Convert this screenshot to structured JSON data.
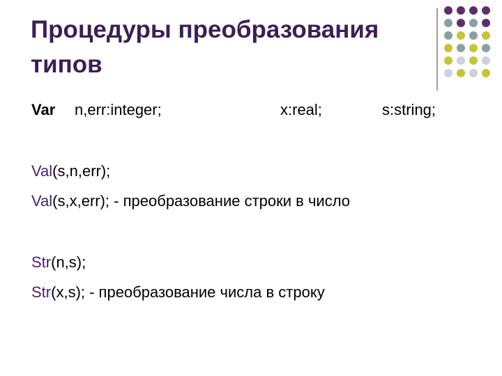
{
  "slide": {
    "title_line1": "Процедуры преобразования",
    "title_line2": "типов",
    "var_line": {
      "keyword": "Var",
      "decl1": "n,err:integer;",
      "decl2": "x:real;",
      "decl3": "s:string;"
    },
    "val1": {
      "fn": "Val",
      "args": "(s,n,err);"
    },
    "val2": {
      "fn": "Val",
      "args": "(s,x,err); - преобразование строки в число"
    },
    "str1": {
      "fn": "Str",
      "args": "(n,s);"
    },
    "str2": {
      "fn": "Str",
      "args": "(x,s); - преобразование числа в строку"
    }
  },
  "colors": {
    "title": "#3b1f56",
    "function_name": "#4b1f66",
    "dot_purple": "#5e2e6a",
    "dot_teal": "#8aa0a0",
    "dot_olive": "#c6c437",
    "dot_lavender": "#cfcfe0",
    "divider": "#9a9a9a"
  },
  "decoration": {
    "dot_grid": [
      [
        "purple",
        "purple",
        "purple",
        "purple"
      ],
      [
        "teal",
        "purple",
        "teal",
        "purple"
      ],
      [
        "teal",
        "olive",
        "teal",
        "olive"
      ],
      [
        "olive",
        "teal",
        "olive",
        "teal"
      ],
      [
        "olive",
        "lavender",
        "olive",
        "lavender"
      ],
      [
        "lavender",
        "olive",
        "lavender",
        "olive"
      ]
    ]
  }
}
